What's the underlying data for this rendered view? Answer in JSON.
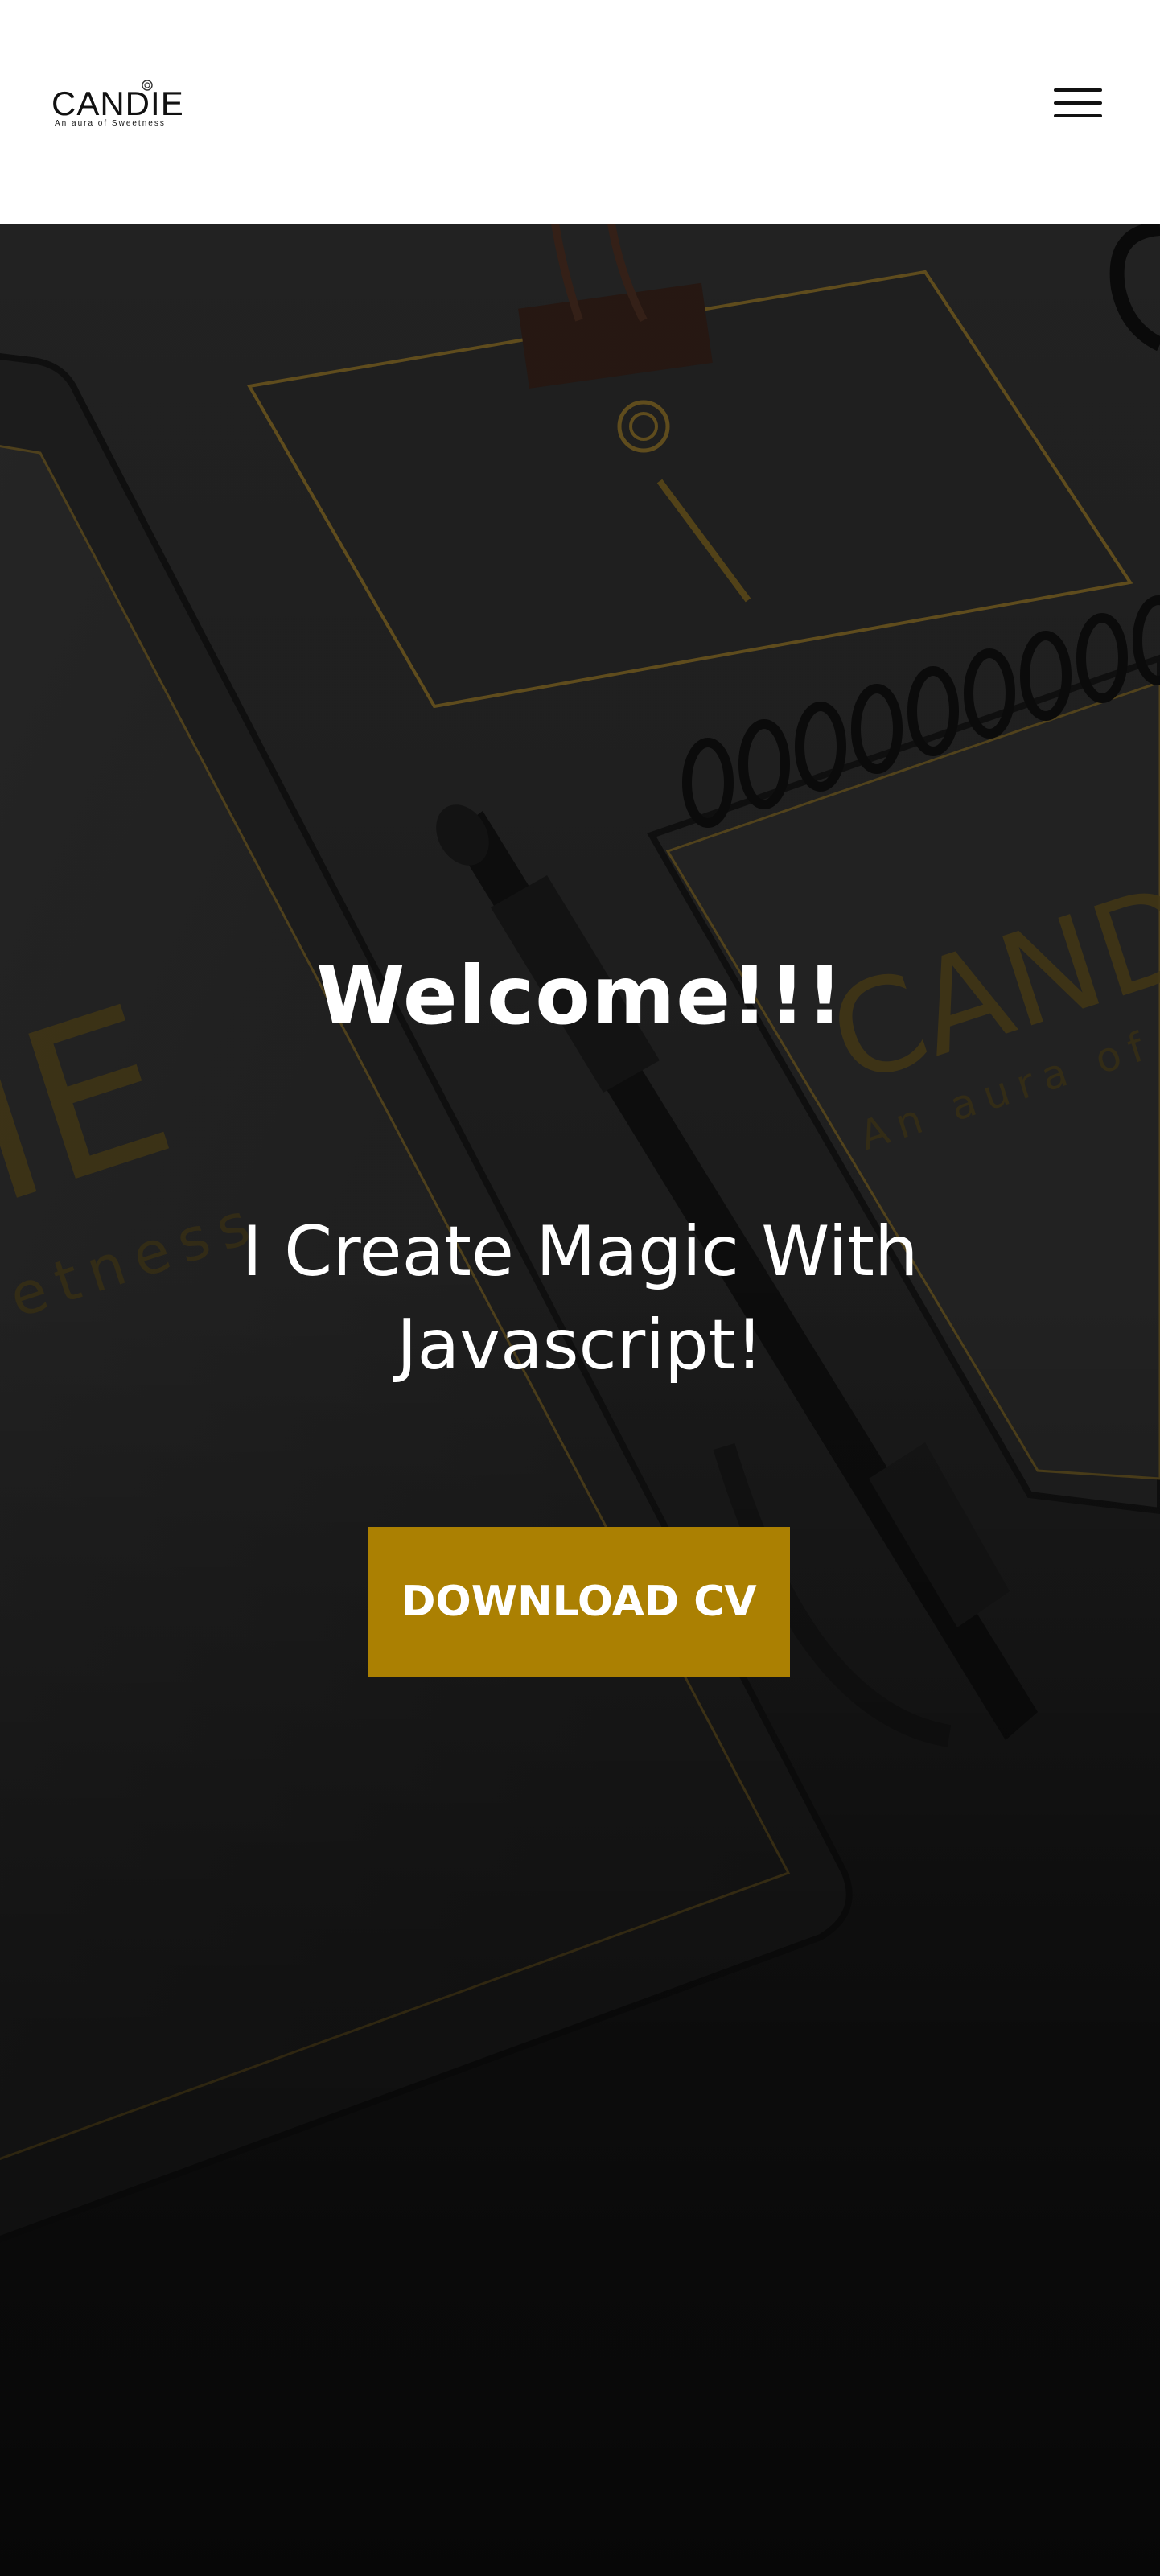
{
  "header": {
    "logo": {
      "wordmark": "CANDIE",
      "tagline": "An aura of Sweetness"
    },
    "menu_icon": "hamburger-menu-icon"
  },
  "hero": {
    "title": "Welcome!!!",
    "subtitle": "I Create Magic With Javascript!",
    "cta_label": "DOWNLOAD CV",
    "background_image": "dark stationery mockup with gold CANDIE branding",
    "colors": {
      "accent": "#ab8002",
      "text": "#ffffff",
      "header_bg": "#ffffff"
    }
  }
}
